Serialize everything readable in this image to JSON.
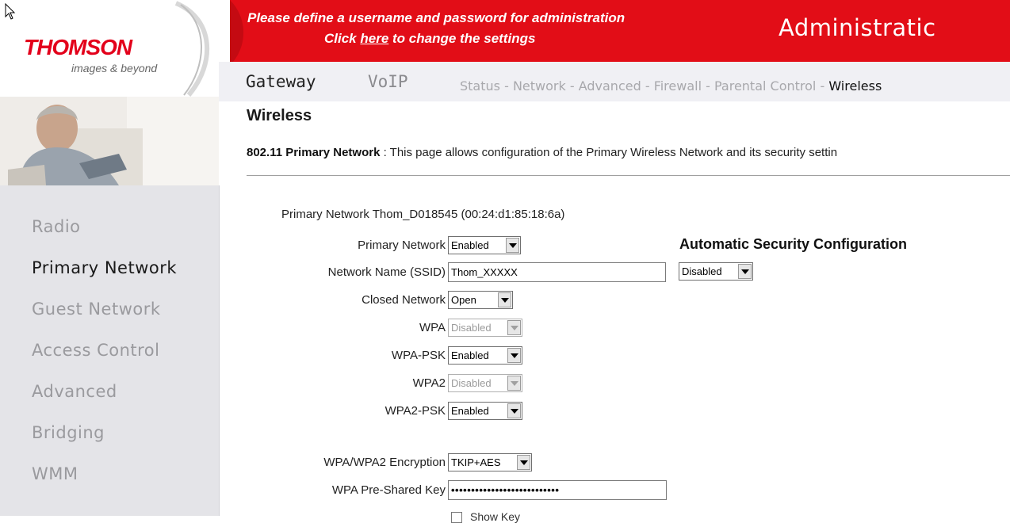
{
  "brand": {
    "name": "THOMSON",
    "tagline": "images & beyond"
  },
  "banner": {
    "notice_line1": "Please define a username and password for administration",
    "notice_click": "Click ",
    "notice_here": "here",
    "notice_rest": " to change the settings",
    "title": "Administratic"
  },
  "nav": {
    "tabs": [
      "Gateway",
      "VoIP"
    ],
    "subnav": [
      "Status",
      "Network",
      "Advanced",
      "Firewall",
      "Parental Control",
      "Wireless"
    ],
    "separator": " - "
  },
  "sidebar": {
    "items": [
      "Radio",
      "Primary Network",
      "Guest Network",
      "Access Control",
      "Advanced",
      "Bridging",
      "WMM"
    ],
    "active": "Primary Network"
  },
  "page": {
    "title": "Wireless",
    "desc_bold": "802.11 Primary Network",
    "desc_sep": " : ",
    "desc_text": "This page allows configuration of the Primary Wireless Network and its security settin"
  },
  "form": {
    "network_heading": "Primary Network Thom_D018545 (00:24:d1:85:18:6a)",
    "primary_network": {
      "label": "Primary Network",
      "value": "Enabled"
    },
    "ssid": {
      "label": "Network Name (SSID)",
      "value": "Thom_XXXXX"
    },
    "closed_network": {
      "label": "Closed Network",
      "value": "Open"
    },
    "wpa": {
      "label": "WPA",
      "value": "Disabled",
      "disabled": true
    },
    "wpa_psk": {
      "label": "WPA-PSK",
      "value": "Enabled"
    },
    "wpa2": {
      "label": "WPA2",
      "value": "Disabled",
      "disabled": true
    },
    "wpa2_psk": {
      "label": "WPA2-PSK",
      "value": "Enabled"
    },
    "encryption": {
      "label": "WPA/WPA2 Encryption",
      "value": "TKIP+AES"
    },
    "psk": {
      "label": "WPA Pre-Shared Key",
      "value": "•••••••••••••••••••••••••••"
    },
    "show_key": {
      "label": "Show Key",
      "checked": false
    },
    "auto_security": {
      "heading": "Automatic Security Configuration",
      "value": "Disabled"
    }
  },
  "colors": {
    "accent_red": "#e20d17",
    "nav_bg": "#f0f0f4",
    "sidebar_bg": "#e4e4e8"
  }
}
